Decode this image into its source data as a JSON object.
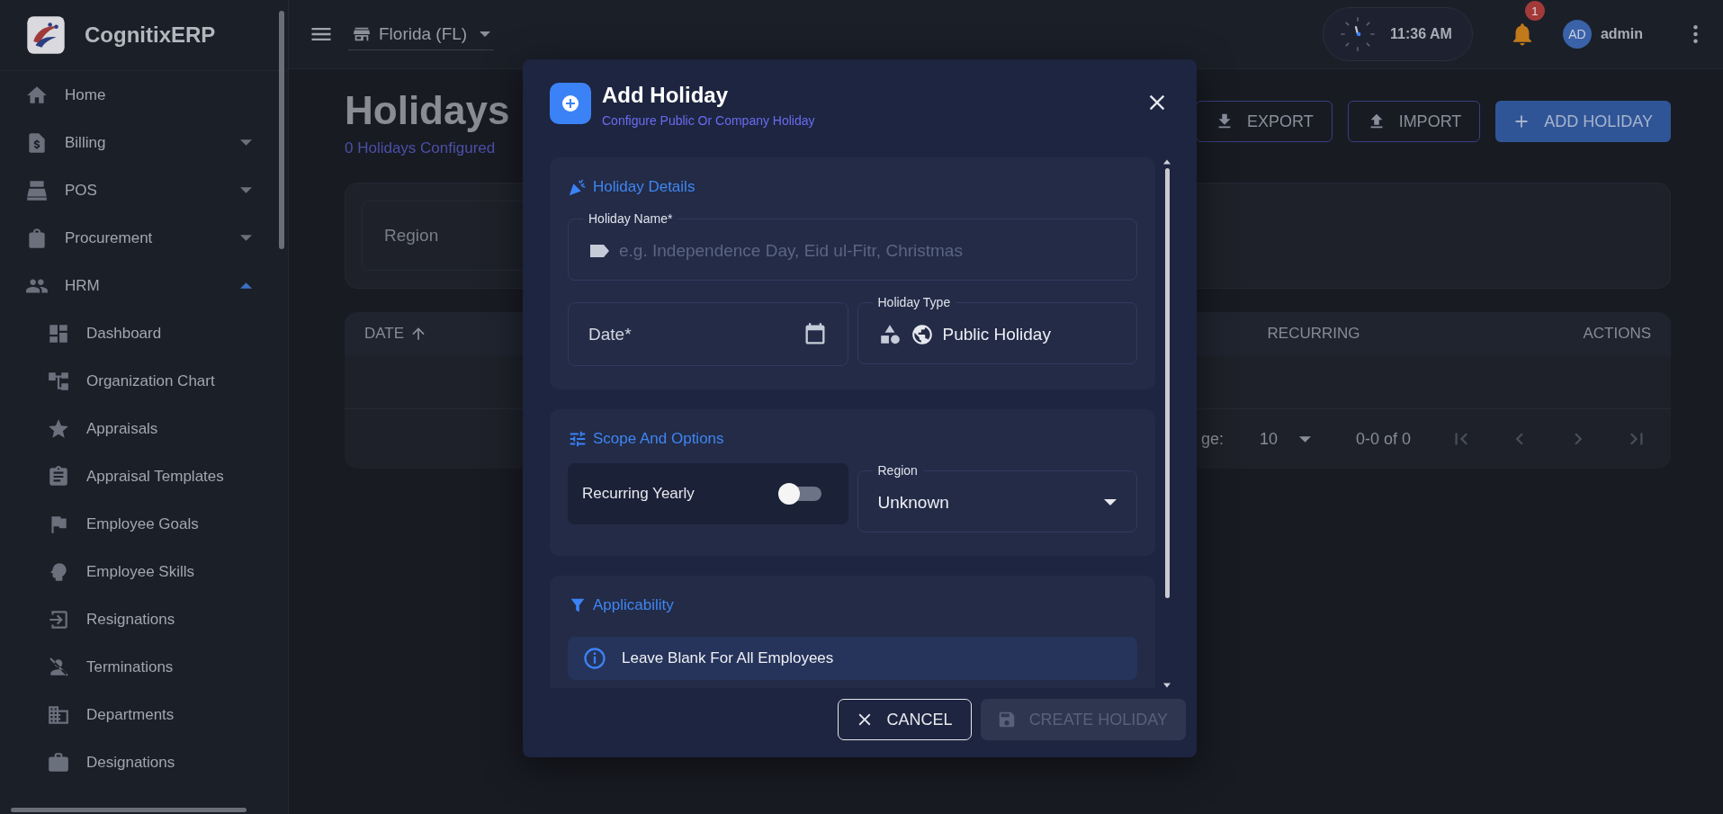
{
  "app": {
    "name": "CognitixERP"
  },
  "sidebar": {
    "items": [
      {
        "label": "Home",
        "kind": "link"
      },
      {
        "label": "Billing",
        "kind": "group",
        "expanded": false
      },
      {
        "label": "POS",
        "kind": "group",
        "expanded": false
      },
      {
        "label": "Procurement",
        "kind": "group",
        "expanded": false
      },
      {
        "label": "HRM",
        "kind": "group",
        "expanded": true,
        "children": [
          {
            "label": "Dashboard"
          },
          {
            "label": "Organization Chart"
          },
          {
            "label": "Appraisals"
          },
          {
            "label": "Appraisal Templates"
          },
          {
            "label": "Employee Goals"
          },
          {
            "label": "Employee Skills"
          },
          {
            "label": "Resignations"
          },
          {
            "label": "Terminations"
          },
          {
            "label": "Departments"
          },
          {
            "label": "Designations"
          }
        ]
      }
    ]
  },
  "topbar": {
    "store": "Florida (FL)",
    "time": "11:36 AM",
    "notification_count": "1",
    "user_initials": "AD",
    "user_name": "admin"
  },
  "page": {
    "title": "Holidays",
    "subtitle": "0 Holidays Configured",
    "actions": [
      {
        "label": "EXPORT",
        "kind": "export"
      },
      {
        "label": "IMPORT",
        "kind": "import"
      },
      {
        "label": "ADD HOLIDAY",
        "kind": "add"
      }
    ],
    "filter": {
      "placeholder": "Region"
    },
    "table": {
      "columns": [
        {
          "label": "DATE",
          "sorted": true
        },
        {
          "label": "RECURRING",
          "sorted": false
        },
        {
          "label": "ACTIONS",
          "sorted": false
        }
      ],
      "pagination": {
        "rows_label": "ge:",
        "rows_per_page": "10",
        "range": "0-0 of 0"
      }
    }
  },
  "dialog": {
    "title": "Add Holiday",
    "subtitle": "Configure Public Or Company Holiday",
    "details": {
      "title": "Holiday Details",
      "name_field": {
        "label": "Holiday Name*",
        "placeholder": "e.g. Independence Day, Eid ul-Fitr, Christmas"
      },
      "date_field": {
        "label": "Date*"
      },
      "type_field": {
        "label": "Holiday Type",
        "value": "Public Holiday"
      }
    },
    "scope": {
      "title": "Scope And Options",
      "recurring": {
        "label": "Recurring Yearly",
        "on": false
      },
      "region_field": {
        "label": "Region",
        "value": "Unknown"
      }
    },
    "applicability": {
      "title": "Applicability",
      "info": "Leave Blank For All Employees"
    },
    "buttons": [
      {
        "label": "CANCEL",
        "kind": "cancel",
        "disabled": false
      },
      {
        "label": "CREATE HOLIDAY",
        "kind": "submit",
        "disabled": true
      }
    ]
  }
}
